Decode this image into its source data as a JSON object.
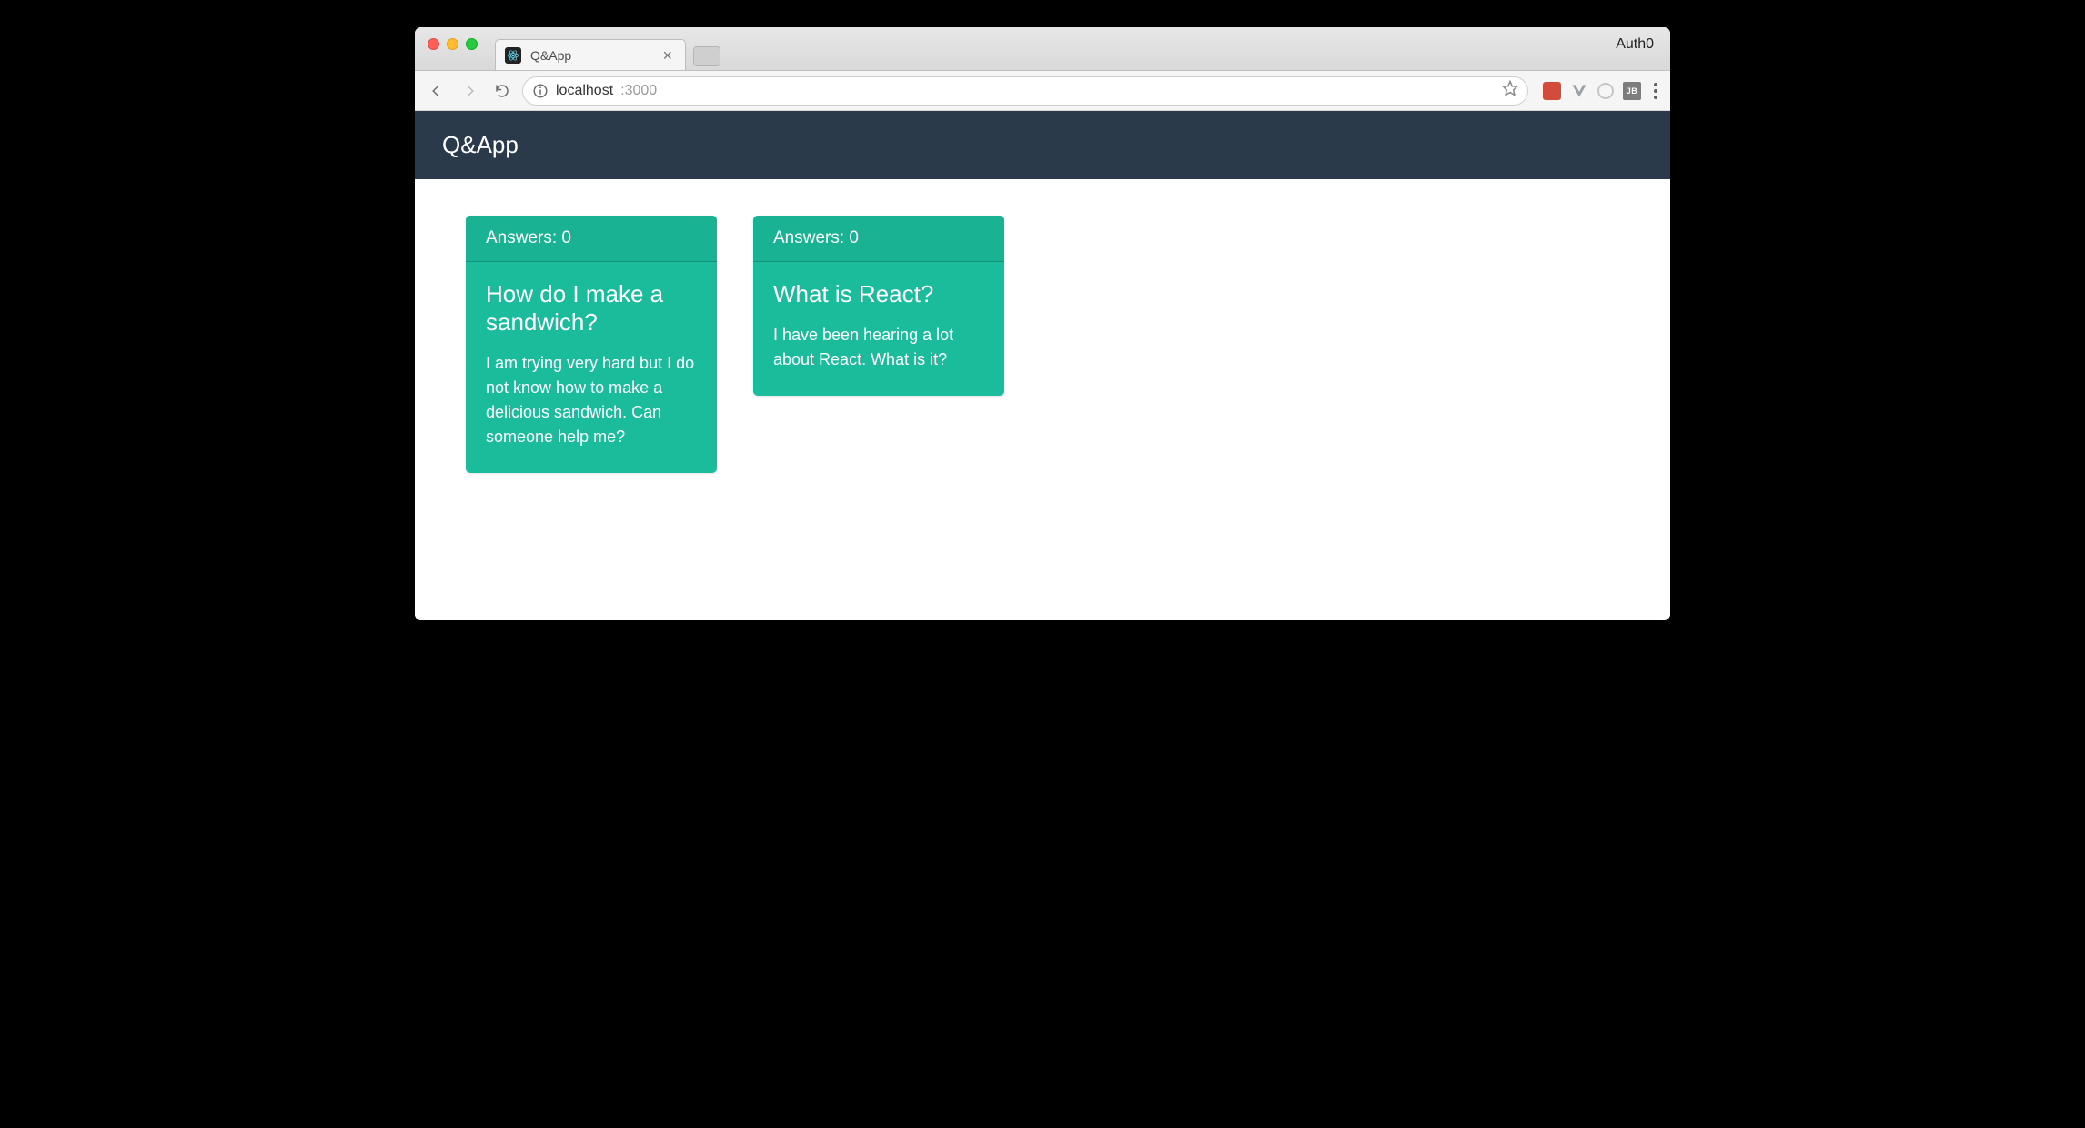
{
  "browser": {
    "system_label": "Auth0",
    "tab": {
      "title": "Q&App"
    },
    "url": {
      "host": "localhost",
      "rest": ":3000"
    },
    "ext_jb_label": "JB"
  },
  "app": {
    "brand": "Q&App",
    "cards": [
      {
        "answers_label": "Answers: 0",
        "title": "How do I make a sandwich?",
        "text": "I am trying very hard but I do not know how to make a delicious sandwich. Can someone help me?"
      },
      {
        "answers_label": "Answers: 0",
        "title": "What is React?",
        "text": "I have been hearing a lot about React. What is it?"
      }
    ]
  }
}
